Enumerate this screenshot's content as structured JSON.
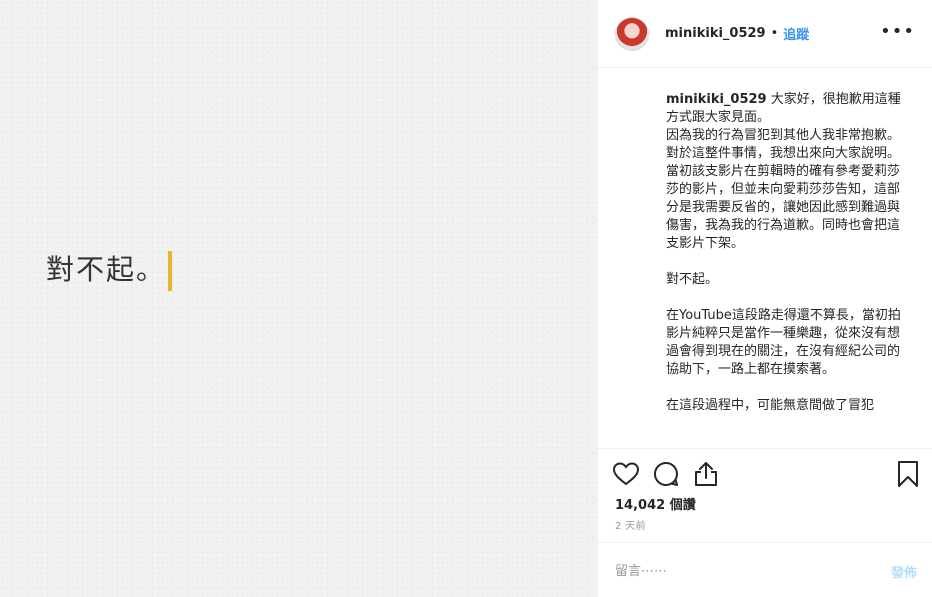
{
  "media": {
    "text": "對不起。",
    "accent_color": "#e8b62c"
  },
  "header": {
    "username": "minikiki_0529",
    "separator": "•",
    "follow_label": "追蹤",
    "more_label": "•••"
  },
  "caption": {
    "username": "minikiki_0529",
    "text": " 大家好，很抱歉用這種方式跟大家見面。\n因為我的行為冒犯到其他人我非常抱歉。對於這整件事情，我想出來向大家說明。\n當初該支影片在剪輯時的確有參考愛莉莎莎的影片，但並未向愛莉莎莎告知，這部分是我需要反省的，讓她因此感到難過與傷害，我為我的行為道歉。同時也會把這支影片下架。\n\n對不起。\n\n在YouTube這段路走得還不算長，當初拍影片純粹只是當作一種樂趣，從來沒有想過會得到現在的關注，在沒有經紀公司的協助下，一路上都在摸索著。\n\n在這段過程中，可能無意間做了冒犯"
  },
  "actions": {
    "like_icon": "heart-icon",
    "comment_icon": "comment-icon",
    "share_icon": "share-icon",
    "save_icon": "bookmark-icon"
  },
  "stats": {
    "views": "14,042 個讚",
    "time_ago": "2 天前"
  },
  "comment": {
    "placeholder": "留言⋯⋯",
    "post_label": "發佈",
    "post_color": "#b2dffc"
  },
  "colors": {
    "link": "#3897f0",
    "border": "#efefef"
  }
}
